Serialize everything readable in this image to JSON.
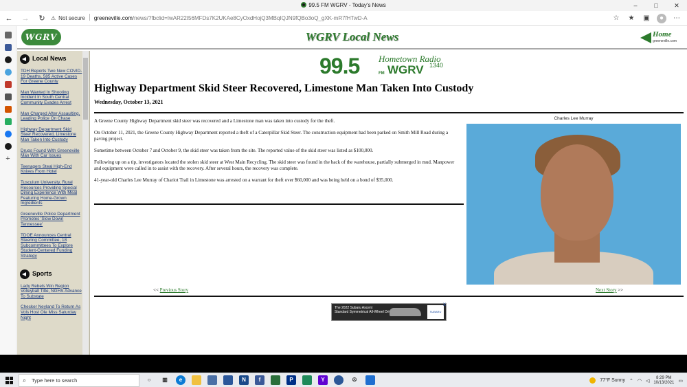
{
  "browser": {
    "tab_title": "99.5 FM WGRV - Today's News",
    "security_label": "Not secure",
    "url_domain": "greeneville.com",
    "url_path": "/news/?fbclid=IwAR22t56MFDs7K2UKAe8CyOxdHojQ3MBqIQJN9fQBo3oQ_gXK-mR7fHTwD-A",
    "window_controls": [
      "–",
      "□",
      "✕"
    ]
  },
  "site": {
    "logo_text": "WGRV",
    "header_title": "WGRV Local News",
    "home_label": "Home",
    "home_sub": "greeneville.com"
  },
  "sidebar": {
    "local_heading": "Local News",
    "local_items": [
      "TDH Reports Two New COVID-19 Deaths, 585 Active Cases For Greene County",
      "Man Wanted In Shooting Incident In South Central Community Evades Arrest",
      "Man Charged After Assaulting, Leading Police On Chase",
      "Highway Department Skid Steer Recovered, Limestone Man Taken Into Custody",
      "Drugs Found With Greeneville Man With Car Issues",
      "Teenagers Steal High-End Knives From Hotel",
      "Tusculum University, Rural Resources Providing Special Dining Experience With Meal Featuring Home-Grown Ingredients",
      "Greeneville Police Department Promotes 'Slow Down Tennessee'",
      "TDOE Announces Central Steering Committee, 18 Subcommittees To Explore Student-Centered Funding Strategy"
    ],
    "sports_heading": "Sports",
    "sports_items": [
      "Lady Rebels Win Region Volleyball Title, NGHS Advance To Substate",
      "Checker Neyland To Return As Vols Host Ole Miss Saturday Night"
    ]
  },
  "brand": {
    "number": "99.5",
    "fm": "FM",
    "tagline": "Hometown Radio",
    "call_sign": "WGRV",
    "am": "1340"
  },
  "article": {
    "headline": "Highway Department Skid Steer Recovered, Limestone Man Taken Into Custody",
    "date": "Wednesday, October 13, 2021",
    "paragraphs": [
      "A Greene County Highway Department skid steer was recovered and a Limestone man was taken into custody for the theft.",
      "On October 11, 2021, the Greene County Highway Department reported a theft of a Caterpillar Skid Steer. The construction equipment had been parked on Smith Mill Road during a paving project.",
      "Sometime between October 7 and October 9, the skid steer was taken from the site. The reported value of the skid steer was listed as $100,000.",
      "Following up on a tip, investigators located the stolen skid steer at West Main Recycling. The skid steer was found in the back of the warehouse, partially submerged in mud. Manpower and equipment were called in to assist with the recovery. After several hours, the recovery was complete.",
      "41-year-old Charles Lee Murray of Chariot Trail in Limestone was arrested on a warrant for theft over $60,000 and was being held on a bond of $35,000."
    ],
    "photo_caption": "Charles Lee Murray",
    "prev_prefix": "<<",
    "prev_label": "Previous Story",
    "next_label": "Next Story",
    "next_suffix": ">>"
  },
  "ad": {
    "line1": "The 2022 Subaru Ascent",
    "line2": "Standard Symmetrical All-Wheel Drive",
    "brand": "SUBARU",
    "close": "X"
  },
  "taskbar": {
    "search_placeholder": "Type here to search",
    "weather": "77°F Sunny",
    "time": "8:29 PM",
    "date": "10/13/2021"
  }
}
